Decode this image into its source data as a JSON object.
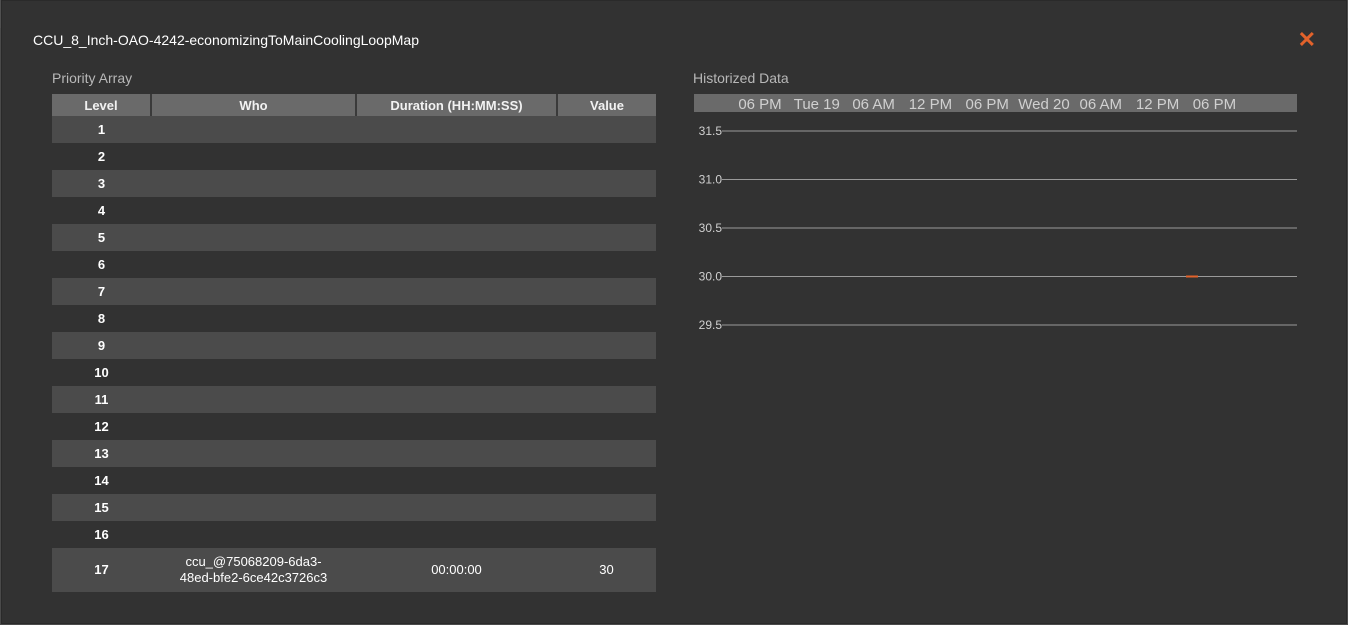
{
  "modal": {
    "title": "CCU_8_Inch-OAO-4242-economizingToMainCoolingLoopMap",
    "close_symbol": "✕"
  },
  "priority_array": {
    "heading": "Priority Array",
    "columns": [
      "Level",
      "Who",
      "Duration (HH:MM:SS)",
      "Value"
    ],
    "rows": [
      {
        "level": "1",
        "who": "",
        "duration": "",
        "value": ""
      },
      {
        "level": "2",
        "who": "",
        "duration": "",
        "value": ""
      },
      {
        "level": "3",
        "who": "",
        "duration": "",
        "value": ""
      },
      {
        "level": "4",
        "who": "",
        "duration": "",
        "value": ""
      },
      {
        "level": "5",
        "who": "",
        "duration": "",
        "value": ""
      },
      {
        "level": "6",
        "who": "",
        "duration": "",
        "value": ""
      },
      {
        "level": "7",
        "who": "",
        "duration": "",
        "value": ""
      },
      {
        "level": "8",
        "who": "",
        "duration": "",
        "value": ""
      },
      {
        "level": "9",
        "who": "",
        "duration": "",
        "value": ""
      },
      {
        "level": "10",
        "who": "",
        "duration": "",
        "value": ""
      },
      {
        "level": "11",
        "who": "",
        "duration": "",
        "value": ""
      },
      {
        "level": "12",
        "who": "",
        "duration": "",
        "value": ""
      },
      {
        "level": "13",
        "who": "",
        "duration": "",
        "value": ""
      },
      {
        "level": "14",
        "who": "",
        "duration": "",
        "value": ""
      },
      {
        "level": "15",
        "who": "",
        "duration": "",
        "value": ""
      },
      {
        "level": "16",
        "who": "",
        "duration": "",
        "value": ""
      },
      {
        "level": "17",
        "who": "ccu_@75068209-6da3-48ed-bfe2-6ce42c3726c3",
        "duration": "00:00:00",
        "value": "30"
      }
    ]
  },
  "historized": {
    "heading": "Historized Data"
  },
  "chart_data": {
    "type": "line",
    "x_ticks": [
      "06 PM",
      "Tue 19",
      "06 AM",
      "12 PM",
      "06 PM",
      "Wed 20",
      "06 AM",
      "12 PM",
      "06 PM"
    ],
    "y_ticks": [
      31.5,
      31.0,
      30.5,
      30.0,
      29.5
    ],
    "ylim": [
      29.5,
      31.5
    ],
    "grid": true,
    "series": [
      {
        "color": "#e2622b",
        "points": [
          {
            "x": "Wed 20 ~10 AM",
            "y": 30
          }
        ]
      }
    ],
    "tick_color": "#d0d0d0",
    "grid_color": "#9a9a9a",
    "axis_band_color": "#6a6a6a"
  }
}
